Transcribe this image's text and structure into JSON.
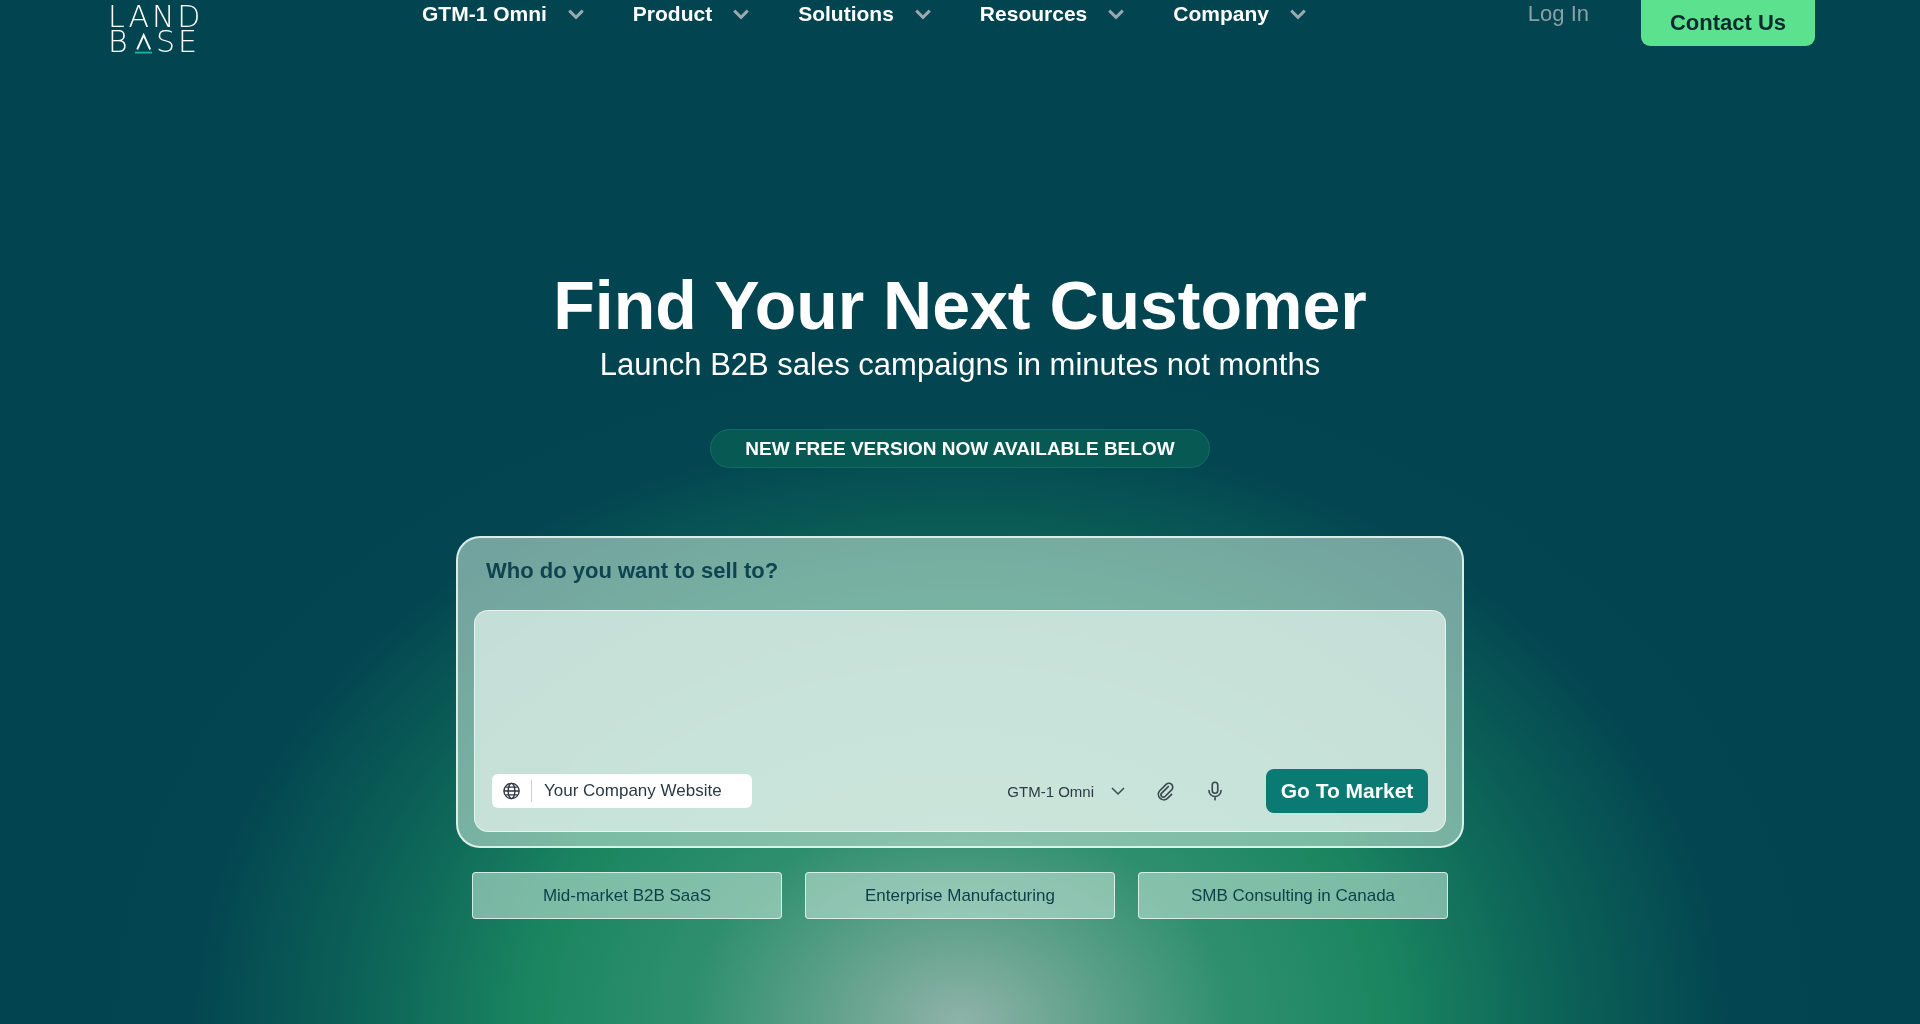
{
  "logo": {
    "top": "LAND",
    "bottom_left": "B",
    "bottom_right": "SE"
  },
  "nav": [
    {
      "label": "GTM-1 Omni",
      "dropdown": true
    },
    {
      "label": "Product",
      "dropdown": true
    },
    {
      "label": "Solutions",
      "dropdown": true
    },
    {
      "label": "Resources",
      "dropdown": true
    },
    {
      "label": "Company",
      "dropdown": true
    }
  ],
  "login": "Log In",
  "contact_button": "Contact Us",
  "hero": {
    "title": "Find Your Next Customer",
    "subtitle": "Launch B2B sales campaigns in minutes not months",
    "badge": "NEW FREE VERSION NOW AVAILABLE BELOW"
  },
  "prompt_card": {
    "label": "Who do you want to sell to?",
    "website_field": {
      "placeholder": "Your Company Website"
    },
    "model_select": "GTM-1 Omni",
    "submit": "Go To Market"
  },
  "suggestions": [
    "Mid-market B2B SaaS",
    "Enterprise Manufacturing",
    "SMB Consulting in Canada"
  ]
}
